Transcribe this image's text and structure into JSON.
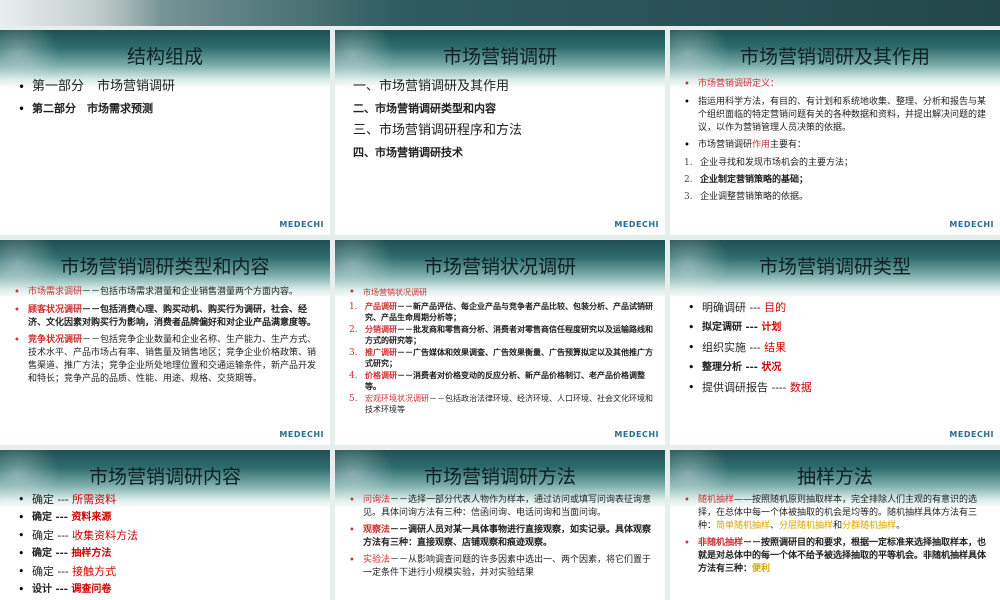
{
  "brand": "MEDECHI",
  "slides": [
    {
      "title": "结构组成",
      "items": [
        {
          "text": "第一部分　市场营销调研"
        },
        {
          "text": "第二部分　市场需求预测"
        }
      ]
    },
    {
      "title": "市场营销调研",
      "items": [
        {
          "text": "一、市场营销调研及其作用"
        },
        {
          "text": "二、市场营销调研类型和内容"
        },
        {
          "text": "三、市场营销调研程序和方法"
        },
        {
          "text": "四、市场营销调研技术"
        }
      ]
    },
    {
      "title": "市场营销调研及其作用",
      "def_label": "市场营销调研定义：",
      "def_text": "指运用科学方法，有目的、有计划和系统地收集、整理、分析和报告与某个组织面临的特定营销问题有关的各种数据和资料，并提出解决问题的建议，以作为营销管理人员决策的依据。",
      "role_intro_a": "市场营销调研",
      "role_intro_b": "作用",
      "role_intro_c": "主要有：",
      "roles": [
        {
          "num": "1.",
          "text": "企业寻找和发现市场机会的主要方法；"
        },
        {
          "num": "2.",
          "text": "企业制定营销策略的基础；"
        },
        {
          "num": "3.",
          "text": "企业调整营销策略的依据。"
        }
      ]
    },
    {
      "title": "市场营销调研类型和内容",
      "items": [
        {
          "label": "市场需求调研",
          "text": "－－包括市场需求潜量和企业销售潜量两个方面内容。"
        },
        {
          "label": "顾客状况调研",
          "text": "－－包括消费心理、购买动机、购买行为调研，社会、经济、文化因素对购买行为影响，消费者品牌偏好和对企业产品满意度等。"
        },
        {
          "label": "竞争状况调研",
          "text": "－－包括竞争企业数量和企业名称、生产能力、生产方式、技术水平、产品市场占有率、销售量及销售地区；竞争企业价格政策、销售渠道、推广方法；竞争企业所处地理位置和交通运输条件，新产品开发和特长；竞争产品的品质、性能、用途、规格、交货期等。"
        }
      ]
    },
    {
      "title": "市场营销状况调研",
      "heading": "市场营销状况调研",
      "items": [
        {
          "num": "1.",
          "label": "产品调研",
          "text": "－－新产品评估、每企业产品与竞争者产品比较、包装分析、产品试销研究、产品生命周期分析等；"
        },
        {
          "num": "2.",
          "label": "分销调研",
          "text": "－－批发商和零售商分析、消费者对零售商信任程度研究以及运输路线和方式的研究等；"
        },
        {
          "num": "3.",
          "label": "推广调研",
          "text": "－－广告媒体和效果调查、广告效果衡量、广告预算拟定以及其他推广方式研究；"
        },
        {
          "num": "4.",
          "label": "价格调研",
          "text": "－－消费者对价格变动的反应分析、新产品价格制订、老产品价格调整等。"
        },
        {
          "num": "5.",
          "label": "宏观环境状况调研",
          "text": "－－包括政治法律环境、经济环境、人口环境、社会文化环境和技术环境等"
        }
      ]
    },
    {
      "title": "市场营销调研类型",
      "items": [
        {
          "a": "明确调研 --- ",
          "b": "目的"
        },
        {
          "a": "拟定调研 --- ",
          "b": "计划"
        },
        {
          "a": "组织实施 --- ",
          "b": "结果"
        },
        {
          "a": "整理分析 --- ",
          "b": "状况"
        },
        {
          "a": "提供调研报告 ---- ",
          "b": "数据"
        }
      ]
    },
    {
      "title": "市场营销调研内容",
      "items": [
        {
          "a": "确定 --- ",
          "b": "所需资料"
        },
        {
          "a": "确定 --- ",
          "b": "资料来源"
        },
        {
          "a": "确定 --- ",
          "b": "收集资料方法"
        },
        {
          "a": "确定 --- ",
          "b": "抽样方法"
        },
        {
          "a": "确定 --- ",
          "b": "接触方式"
        },
        {
          "a": "设计 --- ",
          "b": "调查问卷"
        }
      ]
    },
    {
      "title": "市场营销调研方法",
      "items": [
        {
          "label": "问询法",
          "text": "－－选择一部分代表人物作为样本，通过访问或填写问询表征询意见。具体问询方法有三种：信函问询、电话问询和当面问询。"
        },
        {
          "label": "观察法",
          "text": "－－调研人员对某一具体事物进行直接观察，如实记录。具体观察方法有三种：直接观察、店铺观察和痕迹观察。"
        },
        {
          "label": "实验法",
          "text": "－－从影响调查问题的许多因素中选出一、两个因素，将它们置于一定条件下进行小规模实验，并对实验结果"
        }
      ]
    },
    {
      "title": "抽样方法",
      "items": [
        {
          "label": "随机抽样",
          "text_a": "——按照随机原则抽取样本，完全排除人们主观的有意识的选择，在总体中每一个体被抽取的机会是均等的。随机抽样具体方法有三种：",
          "hl1": "简单随机抽样",
          "sep1": "、",
          "hl2": "分层随机抽样",
          "sep2": "和",
          "hl3": "分群随机抽样",
          "end": "。"
        },
        {
          "label": "非随机抽样",
          "text_a": "－－按照调研目的和要求，根据一定标准来选择抽取样本，也就是对总体中的每一个体不给予被选择抽取的平等机会。非随机抽样具体方法有三种：",
          "hl1": "便利",
          "sep1": "",
          "hl2": "",
          "sep2": "",
          "hl3": "",
          "end": ""
        }
      ]
    }
  ]
}
